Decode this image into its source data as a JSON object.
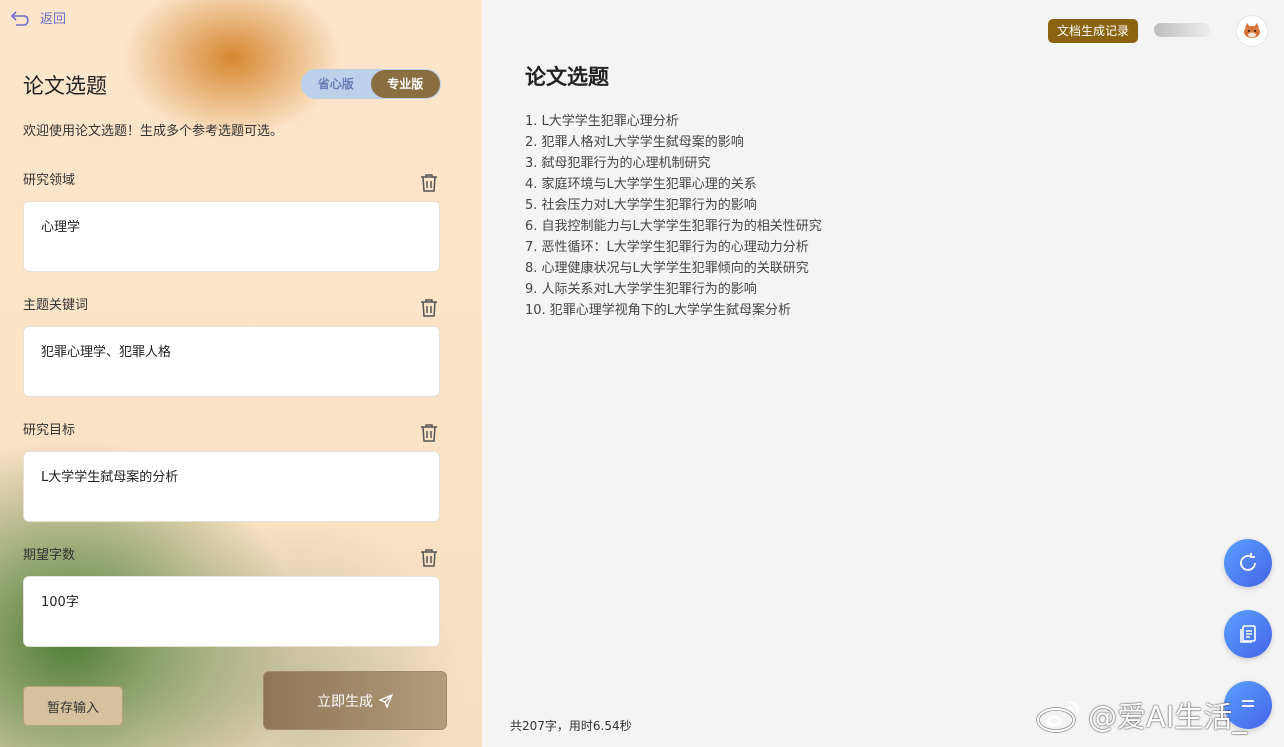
{
  "left": {
    "back_label": "返回",
    "title": "论文选题",
    "modes": [
      "省心版",
      "专业版"
    ],
    "active_mode": "专业版",
    "welcome": "欢迎使用论文选题！生成多个参考选题可选。",
    "fields": [
      {
        "label": "研究领域",
        "value": "心理学"
      },
      {
        "label": "主题关键词",
        "value": "犯罪心理学、犯罪人格"
      },
      {
        "label": "研究目标",
        "value": "L大学学生弑母案的分析"
      },
      {
        "label": "期望字数",
        "value": "100字"
      }
    ],
    "save_label": "暂存输入",
    "generate_label": "立即生成"
  },
  "right": {
    "record_label": "文档生成记录",
    "doc_title": "论文选题",
    "topics": [
      "1. L大学学生犯罪心理分析",
      "2. 犯罪人格对L大学学生弑母案的影响",
      "3. 弑母犯罪行为的心理机制研究",
      "4. 家庭环境与L大学学生犯罪心理的关系",
      "5. 社会压力对L大学学生犯罪行为的影响",
      "6. 自我控制能力与L大学学生犯罪行为的相关性研究",
      "7. 恶性循环：L大学学生犯罪行为的心理动力分析",
      "8. 心理健康状况与L大学学生犯罪倾向的关联研究",
      "9. 人际关系对L大学学生犯罪行为的影响",
      "10. 犯罪心理学视角下的L大学学生弑母案分析"
    ],
    "stats": "共207字，用时6.54秒"
  },
  "watermark": "@爱AI生活_",
  "icons": {
    "back": "back-arrow-icon",
    "trash": "trash-icon",
    "send": "send-icon",
    "refresh": "refresh-icon",
    "copy": "copy-icon",
    "avatar": "fox-avatar-icon",
    "weibo": "weibo-logo-icon"
  },
  "colors": {
    "accent_brown": "#8a6f42",
    "record_button": "#8a6310",
    "fab_blue": "#4c6ff0",
    "link_purple": "#6a6fc7"
  }
}
